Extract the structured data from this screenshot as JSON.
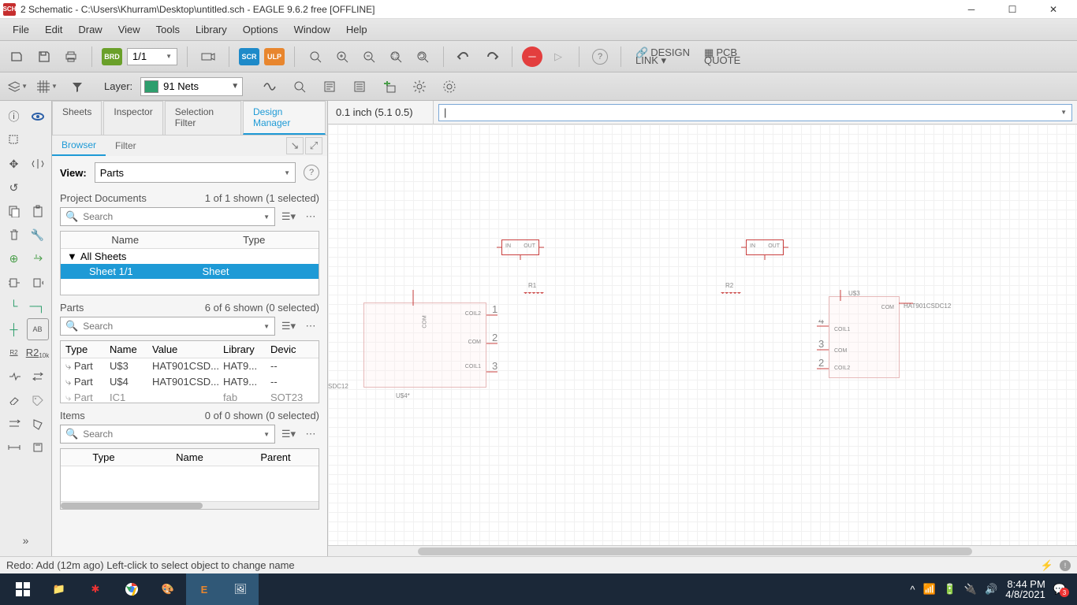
{
  "title": "2 Schematic - C:\\Users\\Khurram\\Desktop\\untitled.sch - EAGLE 9.6.2 free [OFFLINE]",
  "menu": {
    "file": "File",
    "edit": "Edit",
    "draw": "Draw",
    "view": "View",
    "tools": "Tools",
    "library": "Library",
    "options": "Options",
    "window": "Window",
    "help": "Help"
  },
  "toolbar": {
    "sheet_badge": "BRD",
    "sheet_combo": "1/1",
    "scr": "SCR",
    "ulp": "ULP",
    "design_link1": "DESIGN",
    "design_link2": "LINK ▾",
    "pcb1": "PCB",
    "pcb2": "QUOTE"
  },
  "layerbar": {
    "label": "Layer:",
    "value": "91 Nets"
  },
  "sidepanel": {
    "tabs": {
      "sheets": "Sheets",
      "inspector": "Inspector",
      "selection": "Selection Filter",
      "design": "Design Manager"
    },
    "subtabs": {
      "browser": "Browser",
      "filter": "Filter"
    },
    "view_label": "View:",
    "view_value": "Parts",
    "proj_docs": {
      "label": "Project Documents",
      "count": "1 of 1 shown (1 selected)",
      "cols": {
        "name": "Name",
        "type": "Type"
      },
      "row_all": "All Sheets",
      "row_sheet_name": "Sheet 1/1",
      "row_sheet_type": "Sheet"
    },
    "parts": {
      "label": "Parts",
      "count": "6 of 6 shown (0 selected)",
      "cols": {
        "type": "Type",
        "name": "Name",
        "value": "Value",
        "library": "Library",
        "device": "Devic"
      },
      "rows": [
        {
          "t": "Part",
          "n": "U$3",
          "v": "HAT901CSD...",
          "l": "HAT9...",
          "d": "--"
        },
        {
          "t": "Part",
          "n": "U$4",
          "v": "HAT901CSD...",
          "l": "HAT9...",
          "d": "--"
        },
        {
          "t": "Part",
          "n": "IC1",
          "v": "",
          "l": "fab",
          "d": "SOT23"
        }
      ]
    },
    "items": {
      "label": "Items",
      "count": "0 of 0 shown (0 selected)",
      "cols": {
        "type": "Type",
        "name": "Name",
        "parent": "Parent"
      }
    },
    "search_placeholder": "Search"
  },
  "canvas": {
    "coord": "0.1 inch (5.1 0.5)",
    "labels": {
      "r1": "R1",
      "r2": "R2",
      "us3": "U$3",
      "us4": "U$4*",
      "sdc12_left": "SDC12",
      "sdc12_right": "HAT901CSDC12",
      "coil1": "COIL1",
      "coil2": "COIL2",
      "com": "COM",
      "in": "IN",
      "out": "OUT"
    }
  },
  "status": {
    "text": "Redo: Add (12m ago) Left-click to select object to change name"
  },
  "taskbar": {
    "time": "8:44 PM",
    "date": "4/8/2021",
    "badge": "3"
  }
}
